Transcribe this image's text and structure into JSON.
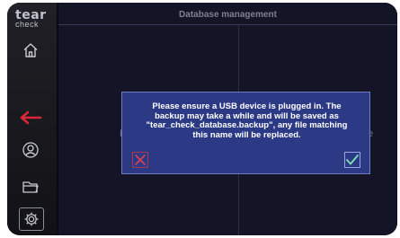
{
  "app": {
    "logo_line1": "tear",
    "logo_line2": "check"
  },
  "header": {
    "title": "Database management"
  },
  "background": {
    "left_letter": "R",
    "right_letter": "e"
  },
  "dialog": {
    "message": "Please ensure a USB device is plugged in. The\nbackup may take a while and will be saved as\n\"tear_check_database.backup\", any file matching\nthis name will be replaced."
  },
  "sidebar": {
    "items": [
      {
        "icon": "home-icon"
      },
      {
        "icon": "back-arrow-icon",
        "color": "#d8273a"
      },
      {
        "icon": "patient-icon"
      },
      {
        "icon": "folder-icon"
      },
      {
        "icon": "settings-icon"
      }
    ]
  },
  "colors": {
    "accent_red": "#d8273a",
    "dialog_bg": "#2c3a86",
    "check_green": "#7fe0b0",
    "cancel_red": "#e0404f"
  }
}
